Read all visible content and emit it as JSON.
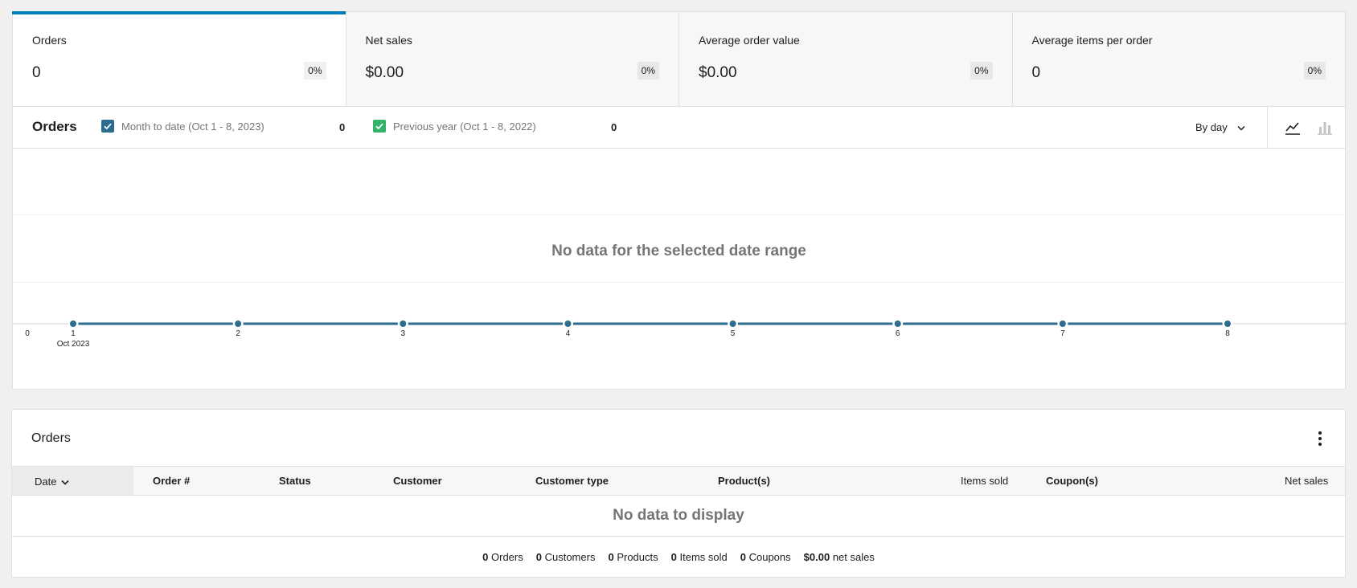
{
  "summary": [
    {
      "label": "Orders",
      "value": "0",
      "delta": "0%"
    },
    {
      "label": "Net sales",
      "value": "$0.00",
      "delta": "0%"
    },
    {
      "label": "Average order value",
      "value": "$0.00",
      "delta": "0%"
    },
    {
      "label": "Average items per order",
      "value": "0",
      "delta": "0%"
    }
  ],
  "chart": {
    "title": "Orders",
    "legend": [
      {
        "label": "Month to date (Oct 1 - 8, 2023)",
        "total": "0",
        "color": "#2c6d8f"
      },
      {
        "label": "Previous year (Oct 1 - 8, 2022)",
        "total": "0",
        "color": "#34b36b"
      }
    ],
    "interval": "By day",
    "chart_type_icons": [
      "line-chart-icon",
      "bar-chart-icon"
    ],
    "no_data": "No data for the selected date range"
  },
  "chart_data": {
    "type": "line",
    "x": [
      "1",
      "2",
      "3",
      "4",
      "5",
      "6",
      "7",
      "8"
    ],
    "x_secondary_label": "Oct 2023",
    "y_tick": "0",
    "series": [
      {
        "name": "Month to date (Oct 1 - 8, 2023)",
        "values": [
          0,
          0,
          0,
          0,
          0,
          0,
          0,
          0
        ]
      }
    ],
    "line_color": "#2c6d8f"
  },
  "table": {
    "title": "Orders",
    "columns": [
      "Date",
      "Order #",
      "Status",
      "Customer",
      "Customer type",
      "Product(s)",
      "Items sold",
      "Coupon(s)",
      "Net sales"
    ],
    "empty": "No data to display",
    "footer": [
      {
        "count": "0",
        "label": "Orders"
      },
      {
        "count": "0",
        "label": "Customers"
      },
      {
        "count": "0",
        "label": "Products"
      },
      {
        "count": "0",
        "label": "Items sold"
      },
      {
        "count": "0",
        "label": "Coupons"
      },
      {
        "count": "$0.00",
        "label": "net sales"
      }
    ]
  }
}
